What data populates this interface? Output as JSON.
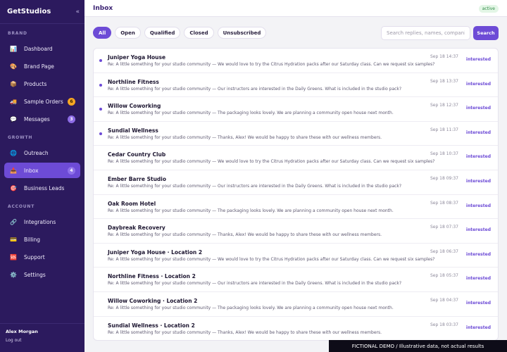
{
  "app": {
    "name": "GetStudios",
    "collapse_glyph": "«"
  },
  "sidebar": {
    "sections": [
      {
        "label": "BRAND",
        "items": [
          {
            "label": "Dashboard",
            "icon": "chart-icon",
            "glyph": "📊"
          },
          {
            "label": "Brand Page",
            "icon": "palette-icon",
            "glyph": "🎨"
          },
          {
            "label": "Products",
            "icon": "box-icon",
            "glyph": "📦"
          },
          {
            "label": "Sample Orders",
            "icon": "truck-icon",
            "glyph": "🚚",
            "badge": "6",
            "badge_color": "#f6a623"
          },
          {
            "label": "Messages",
            "icon": "chat-icon",
            "glyph": "💬",
            "badge": "3",
            "badge_color": "#8d6ce6"
          }
        ]
      },
      {
        "label": "GROWTH",
        "items": [
          {
            "label": "Outreach",
            "icon": "globe-icon",
            "glyph": "🌐"
          },
          {
            "label": "Inbox",
            "icon": "inbox-icon",
            "glyph": "📥",
            "badge": "4",
            "active": true
          },
          {
            "label": "Business Leads",
            "icon": "target-icon",
            "glyph": "🎯"
          }
        ]
      },
      {
        "label": "ACCOUNT",
        "items": [
          {
            "label": "Integrations",
            "icon": "link-icon",
            "glyph": "🔗"
          },
          {
            "label": "Billing",
            "icon": "card-icon",
            "glyph": "💳"
          },
          {
            "label": "Support",
            "icon": "sos-icon",
            "glyph": "🆘"
          },
          {
            "label": "Settings",
            "icon": "gear-icon",
            "glyph": "⚙️"
          }
        ]
      }
    ],
    "user": {
      "name": "Alex Morgan",
      "logout_label": "Log out"
    }
  },
  "header": {
    "title": "Inbox",
    "status": "active"
  },
  "filters": [
    "All",
    "Open",
    "Qualified",
    "Closed",
    "Unsubscribed"
  ],
  "active_filter": "All",
  "search": {
    "placeholder": "Search replies, names, companies",
    "button_label": "Search"
  },
  "messages": [
    {
      "name": "Juniper Yoga House",
      "snippet": "Re: A little something for your studio community — We would love to try the Citrus Hydration packs after our Saturday class. Can we request six samples?",
      "time": "Sep 18 14:37",
      "tag": "interested",
      "unread": true
    },
    {
      "name": "Northline Fitness",
      "snippet": "Re: A little something for your studio community — Our instructors are interested in the Daily Greens. What is included in the studio pack?",
      "time": "Sep 18 13:37",
      "tag": "interested",
      "unread": true
    },
    {
      "name": "Willow Coworking",
      "snippet": "Re: A little something for your studio community — The packaging looks lovely. We are planning a community open house next month.",
      "time": "Sep 18 12:37",
      "tag": "interested",
      "unread": true
    },
    {
      "name": "Sundial Wellness",
      "snippet": "Re: A little something for your studio community — Thanks, Alex! We would be happy to share these with our wellness members.",
      "time": "Sep 18 11:37",
      "tag": "interested",
      "unread": true
    },
    {
      "name": "Cedar Country Club",
      "snippet": "Re: A little something for your studio community — We would love to try the Citrus Hydration packs after our Saturday class. Can we request six samples?",
      "time": "Sep 18 10:37",
      "tag": "interested",
      "unread": false
    },
    {
      "name": "Ember Barre Studio",
      "snippet": "Re: A little something for your studio community — Our instructors are interested in the Daily Greens. What is included in the studio pack?",
      "time": "Sep 18 09:37",
      "tag": "interested",
      "unread": false
    },
    {
      "name": "Oak Room Hotel",
      "snippet": "Re: A little something for your studio community — The packaging looks lovely. We are planning a community open house next month.",
      "time": "Sep 18 08:37",
      "tag": "interested",
      "unread": false
    },
    {
      "name": "Daybreak Recovery",
      "snippet": "Re: A little something for your studio community — Thanks, Alex! We would be happy to share these with our wellness members.",
      "time": "Sep 18 07:37",
      "tag": "interested",
      "unread": false
    },
    {
      "name": "Juniper Yoga House · Location 2",
      "snippet": "Re: A little something for your studio community — We would love to try the Citrus Hydration packs after our Saturday class. Can we request six samples?",
      "time": "Sep 18 06:37",
      "tag": "interested",
      "unread": false
    },
    {
      "name": "Northline Fitness · Location 2",
      "snippet": "Re: A little something for your studio community — Our instructors are interested in the Daily Greens. What is included in the studio pack?",
      "time": "Sep 18 05:37",
      "tag": "interested",
      "unread": false
    },
    {
      "name": "Willow Coworking · Location 2",
      "snippet": "Re: A little something for your studio community — The packaging looks lovely. We are planning a community open house next month.",
      "time": "Sep 18 04:37",
      "tag": "interested",
      "unread": false
    },
    {
      "name": "Sundial Wellness · Location 2",
      "snippet": "Re: A little something for your studio community — Thanks, Alex! We would be happy to share these with our wellness members.",
      "time": "Sep 18 03:37",
      "tag": "interested",
      "unread": false
    }
  ],
  "banner": "FICTIONAL DEMO  /  Illustrative data, not actual results",
  "colors": {
    "sidebar_bg": "#2c1a5e",
    "accent": "#6d4bd6",
    "status_green": "#2f8a45"
  }
}
